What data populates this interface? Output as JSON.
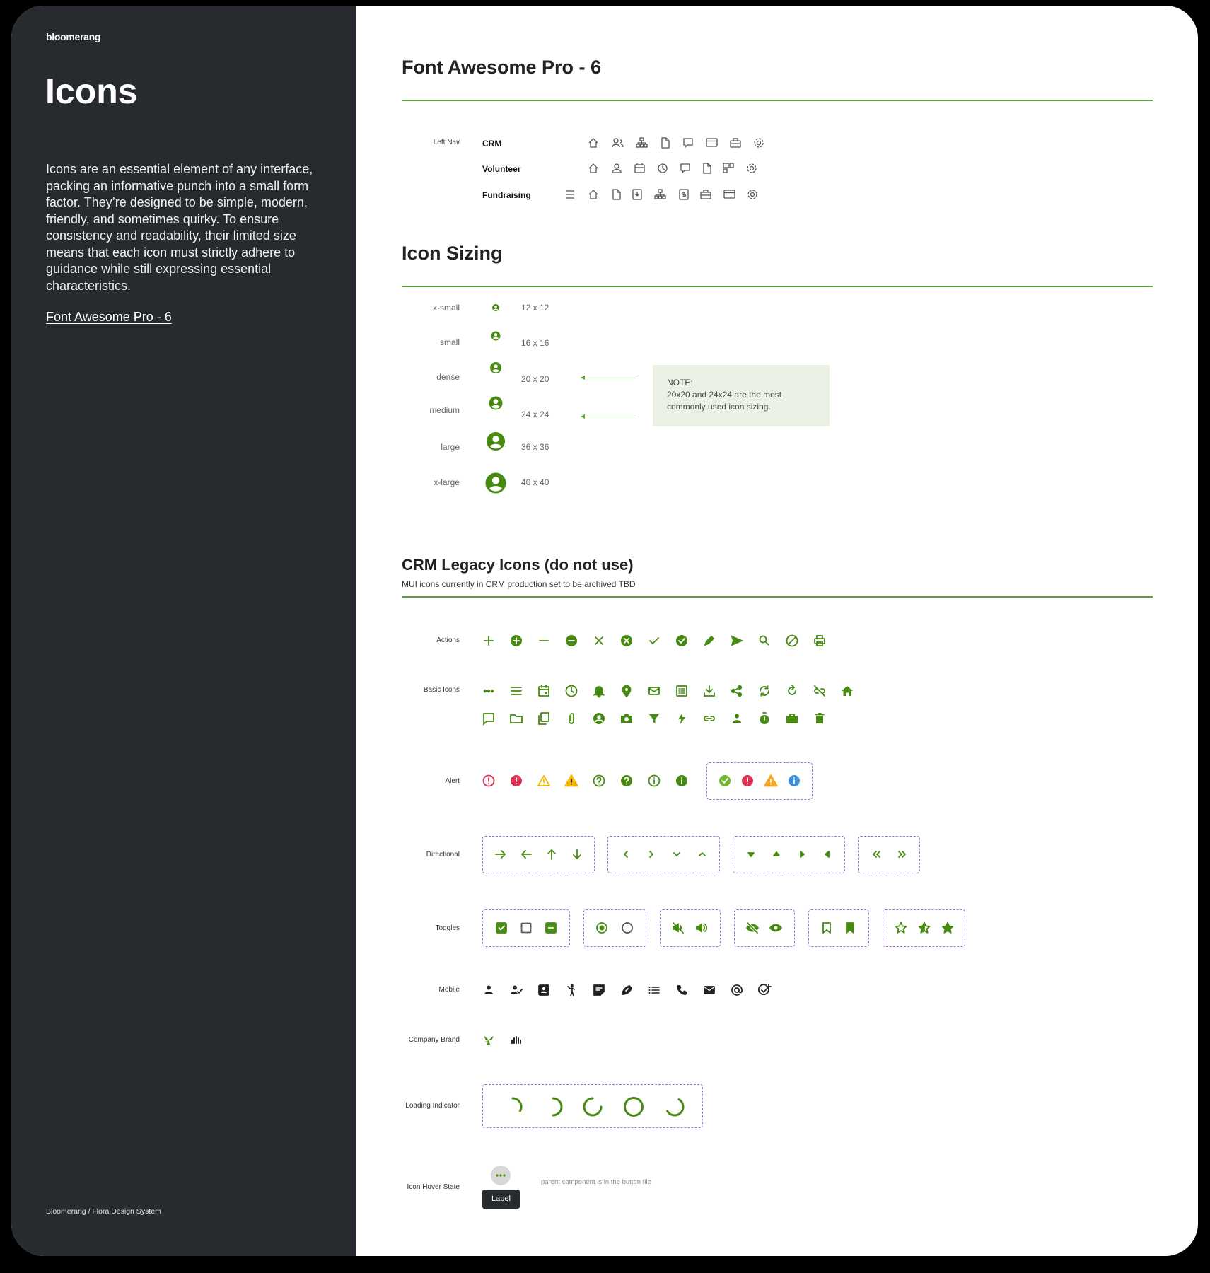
{
  "sidebar": {
    "brand": "bloomerang",
    "title": "Icons",
    "intro": "Icons are an essential element of any interface, packing an informative punch into a small form factor. They’re designed to be simple, modern, friendly, and sometimes quirky. To ensure consistency and readability, their limited size means that each icon must strictly adhere to guidance while still expressing essential characteristics.",
    "link": "Font Awesome Pro - 6",
    "footer": "Bloomerang / Flora Design System"
  },
  "fa": {
    "heading": "Font Awesome Pro - 6",
    "left_nav_label": "Left Nav",
    "rows": [
      {
        "label": "CRM",
        "icons": [
          "house-icon",
          "users-icon",
          "sitemap-icon",
          "file-icon",
          "comment-icon",
          "credit-card-icon",
          "toolbox-icon",
          "gear-icon"
        ]
      },
      {
        "label": "Volunteer",
        "icons": [
          "house-icon",
          "user-icon",
          "calendar-icon",
          "clock-icon",
          "comment-icon",
          "file-icon",
          "layout-icon",
          "gear-icon"
        ]
      },
      {
        "label": "Fundraising",
        "icons": [
          "menu-icon",
          "house-icon",
          "file-icon",
          "file-import-icon",
          "sitemap-icon",
          "dollar-icon",
          "toolbox-icon",
          "credit-card-icon",
          "gear-icon"
        ]
      }
    ]
  },
  "sizing": {
    "heading": "Icon Sizing",
    "rows": [
      {
        "label": "x-small",
        "dim": "12 x 12"
      },
      {
        "label": "small",
        "dim": "16 x 16"
      },
      {
        "label": "dense",
        "dim": "20 x 20"
      },
      {
        "label": "medium",
        "dim": "24 x 24"
      },
      {
        "label": "large",
        "dim": "36 x 36"
      },
      {
        "label": "x-large",
        "dim": "40 x 40"
      }
    ],
    "note_title": "NOTE:",
    "note_body": "20x20 and 24x24 are the most commonly used icon sizing."
  },
  "legacy": {
    "heading": "CRM Legacy Icons (do not use)",
    "subheading": "MUI icons currently in CRM production set to be archived TBD",
    "groups": {
      "actions": "Actions",
      "basic": "Basic Icons",
      "alert": "Alert",
      "directional": "Directional",
      "toggles": "Toggles",
      "mobile": "Mobile",
      "brand": "Company Brand",
      "loading": "Loading Indicator",
      "hover": "Icon Hover State"
    },
    "hover_button_label": "Label",
    "hover_note": "parent component is in the button file"
  },
  "colors": {
    "green": "#468a12",
    "red": "#e0314f",
    "yellow": "#f5b400",
    "blue": "#3f8fd8",
    "purple_dash": "#a86ee8",
    "rule": "#5b9e3a"
  }
}
